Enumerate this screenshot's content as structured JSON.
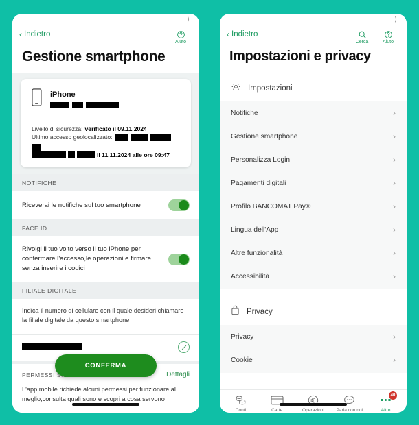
{
  "theme": {
    "background": "#0fbfa6",
    "accent_green": "#1a9a5f",
    "confirm_green": "#1e8c1e",
    "badge_red": "#d0342c"
  },
  "left_phone": {
    "nav": {
      "back_label": "Indietro",
      "help_label": "Aiuto"
    },
    "title": "Gestione smartphone",
    "device_card": {
      "device_name": "iPhone",
      "device_id_redacted": true,
      "security_label": "Livello di sicurezza:",
      "security_value": "verificato il 09.11.2024",
      "last_access_label": "Ultimo accesso geolocalizzato:",
      "last_access_date": "il 11.11.2024 alle ore 09:47"
    },
    "sections": [
      {
        "header": "NOTIFICHE",
        "text": "Riceverai le notifiche sul tuo smartphone",
        "toggle_on": true
      },
      {
        "header": "FACE ID",
        "text": "Rivolgi il tuo volto verso il tuo iPhone per confermare l'accesso,le operazioni e firmare senza inserire i codici",
        "toggle_on": true
      }
    ],
    "filiale": {
      "header": "FILIALE DIGITALE",
      "text": "Indica il numero di cellulare con il quale desideri chiamare la filiale digitale da questo smartphone",
      "phone_value_redacted": true
    },
    "permessi": {
      "header": "PERMESSI SIS",
      "details_link": "Dettagli",
      "text": "L'app mobile richiede alcuni permessi per funzionare al meglio,consulta quali sono e scopri a cosa servono"
    },
    "confirm_button": "CONFERMA"
  },
  "right_phone": {
    "nav": {
      "back_label": "Indietro",
      "search_label": "Cerca",
      "help_label": "Aiuto"
    },
    "title": "Impostazioni e privacy",
    "groups": [
      {
        "name": "Impostazioni",
        "icon": "gear-icon",
        "items": [
          "Notifiche",
          "Gestione smartphone",
          "Personalizza Login",
          "Pagamenti digitali",
          "Profilo BANCOMAT Pay®",
          "Lingua dell'App",
          "Altre funzionalità",
          "Accessibilità"
        ]
      },
      {
        "name": "Privacy",
        "icon": "lock-icon",
        "items": [
          "Privacy",
          "Cookie"
        ]
      }
    ],
    "tabbar": [
      {
        "label": "Conti",
        "icon": "coins-icon",
        "active": false
      },
      {
        "label": "Carte",
        "icon": "card-icon",
        "active": false
      },
      {
        "label": "Operazioni",
        "icon": "euro-icon",
        "active": false
      },
      {
        "label": "Parla con noi",
        "icon": "chat-icon",
        "active": false
      },
      {
        "label": "Altro",
        "icon": "dots-icon",
        "active": true,
        "badge": "40"
      }
    ]
  }
}
